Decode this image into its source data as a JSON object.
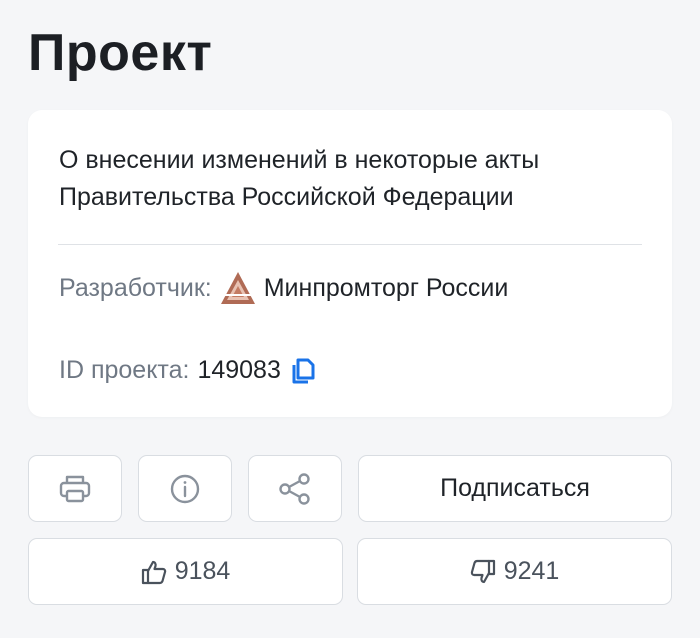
{
  "page": {
    "title": "Проект"
  },
  "project": {
    "description": "О внесении изменений в некоторые акты Правительства Российской Федерации",
    "developer_label": "Разработчик:",
    "developer_name": "Минпромторг России",
    "id_label": "ID проекта:",
    "id_value": "149083"
  },
  "actions": {
    "subscribe_label": "Подписаться",
    "likes": "9184",
    "dislikes": "9241"
  },
  "icons": {
    "print": "printer-icon",
    "info": "info-icon",
    "share": "share-icon",
    "copy": "copy-icon",
    "like": "thumbs-up-icon",
    "dislike": "thumbs-down-icon",
    "developer_logo": "minpromtorg-logo"
  },
  "colors": {
    "accent": "#1a73e8",
    "muted_text": "#6f7884",
    "icon_gray": "#8a929c",
    "background": "#f5f6f8",
    "card": "#ffffff"
  }
}
